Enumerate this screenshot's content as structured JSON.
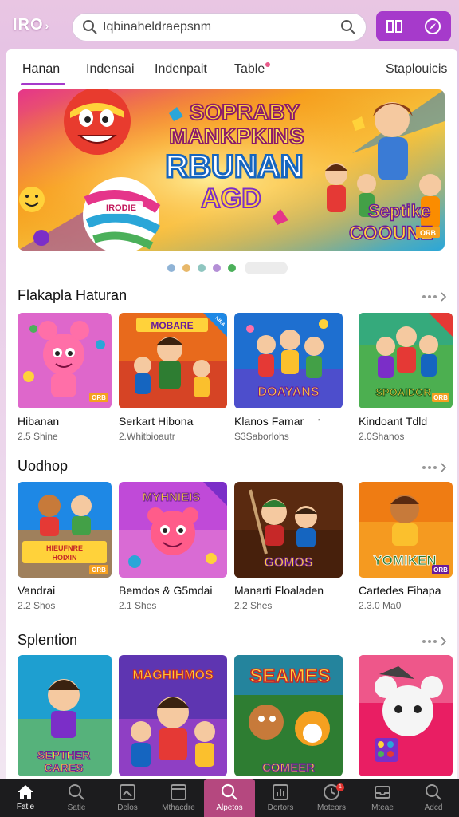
{
  "app": {
    "logo": "IRO",
    "logo_arrow": "›",
    "brand_color": "#a63acb"
  },
  "search": {
    "value": "Iqbinaheldraepsnm",
    "placeholder": ""
  },
  "tabs": [
    {
      "label": "Hanan",
      "active": true
    },
    {
      "label": "Indensai",
      "active": false
    },
    {
      "label": "Indenpait",
      "active": false
    },
    {
      "label": "Table",
      "active": false
    },
    {
      "label": "Staplouicis",
      "active": false
    }
  ],
  "banner": {
    "line1": "SOPRABY",
    "line2": "MANKPKINS",
    "line3": "RBUNAN",
    "line4": "AGD",
    "side1": "Septike",
    "side2": "COOUNE",
    "tag": "ORB",
    "ball_text": "IRODIE"
  },
  "carousel": {
    "dot_colors": [
      "#8fb3d6",
      "#e8b86a",
      "#8fc6c0",
      "#b48fd6",
      "#4bb05a"
    ]
  },
  "sections": [
    {
      "title": "Flakapla Haturan",
      "items": [
        {
          "title": "Hibanan",
          "meta": "2.5 Shine",
          "tag": "ORB"
        },
        {
          "title": "Serkart Hibona",
          "meta": "2.Whitbioautr",
          "tag": "KIRA",
          "art": "MOBARE"
        },
        {
          "title": "Klanos Famar",
          "meta": "S3Saborlohs",
          "tag": "",
          "art": "DOAYANS",
          "suffix": "ʼ"
        },
        {
          "title": "Kindoant Tdld",
          "meta": "2.0Shanos",
          "tag": "ORB",
          "art": "SPOAIDOR"
        }
      ]
    },
    {
      "title": "Uodhop",
      "items": [
        {
          "title": "Vandrai",
          "meta": "2.2 Shos",
          "tag": "ORB",
          "art": "HIEUFNRE HOIXIN"
        },
        {
          "title": "Bemdos & G5mdai",
          "meta": "2.1 Shes",
          "tag": "",
          "art": "MYHNIEIS"
        },
        {
          "title": "Manarti Floaladen",
          "meta": "2.2 Shes",
          "tag": "",
          "art": "GOMOS"
        },
        {
          "title": "Cartedes Fihapa",
          "meta": "2.3.0 Ma0",
          "tag": "ORB",
          "art": "YOMIKEN"
        }
      ]
    },
    {
      "title": "Splention",
      "items": [
        {
          "title": "",
          "meta": "",
          "tag": "",
          "art": "SEPTHER CARES"
        },
        {
          "title": "",
          "meta": "",
          "tag": "",
          "art": "MAGHIHMOS"
        },
        {
          "title": "",
          "meta": "",
          "tag": "",
          "art": "SEAMES COMEER"
        },
        {
          "title": "",
          "meta": "",
          "tag": "",
          "art": ""
        }
      ]
    }
  ],
  "bottom_nav": [
    {
      "label": "Fatie",
      "icon": "home-icon"
    },
    {
      "label": "Satie",
      "icon": "search-icon"
    },
    {
      "label": "Delos",
      "icon": "photo-icon"
    },
    {
      "label": "Mthacdre",
      "icon": "window-icon"
    },
    {
      "label": "Alpetos",
      "icon": "search-icon"
    },
    {
      "label": "Dortors",
      "icon": "chart-icon"
    },
    {
      "label": "Moteors",
      "icon": "clock-icon",
      "badge": "1"
    },
    {
      "label": "Mteae",
      "icon": "inbox-icon"
    },
    {
      "label": "Adcd",
      "icon": "search-icon"
    }
  ]
}
